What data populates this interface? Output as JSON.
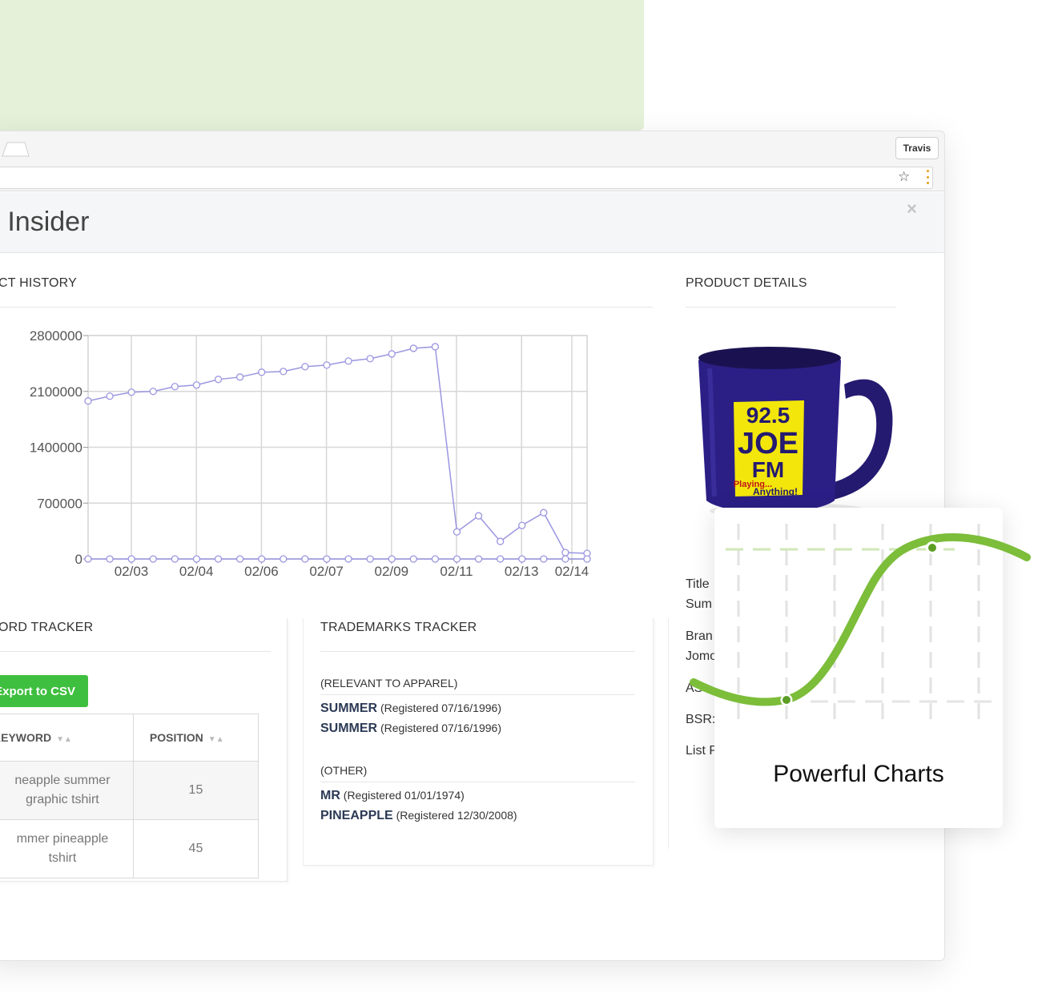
{
  "browser": {
    "profile_name": "Travis"
  },
  "modal": {
    "title": "n Insider"
  },
  "history": {
    "section_title": "CT HISTORY"
  },
  "chart_data": {
    "type": "line",
    "x_tick_labels": [
      "02/03",
      "02/04",
      "02/06",
      "02/07",
      "02/09",
      "02/11",
      "02/13",
      "02/14"
    ],
    "y_tick_labels": [
      "2800000",
      "2100000",
      "1400000",
      "700000",
      "0"
    ],
    "ylim": [
      0,
      2800000
    ],
    "grid": true,
    "series": [
      {
        "color": "#9b96e0",
        "values": [
          1980000,
          2040000,
          2090000,
          2100000,
          2160000,
          2180000,
          2250000,
          2280000,
          2340000,
          2350000,
          2410000,
          2430000,
          2480000,
          2510000,
          2570000,
          2640000,
          2660000,
          340000,
          540000,
          220000,
          420000,
          580000,
          80000,
          70000
        ]
      },
      {
        "color": "#9b96e0",
        "values": [
          0,
          0,
          0,
          0,
          0,
          0,
          0,
          0,
          0,
          0,
          0,
          0,
          0,
          0,
          0,
          0,
          0,
          0,
          0,
          0,
          0,
          0,
          0,
          0
        ]
      }
    ]
  },
  "keyword_tracker": {
    "section_title": "ORD TRACKER",
    "export_label": "Export to CSV",
    "columns": [
      "KEYWORD",
      "POSITION"
    ],
    "rows": [
      {
        "keyword_line1": "neapple summer",
        "keyword_line2": "graphic tshirt",
        "position": "15"
      },
      {
        "keyword_line1": "mmer pineapple",
        "keyword_line2": "tshirt",
        "position": "45"
      }
    ]
  },
  "trademarks": {
    "section_title": "TRADEMARKS TRACKER",
    "groups": [
      {
        "label": "(RELEVANT TO APPAREL)",
        "items": [
          {
            "mark": "SUMMER",
            "detail": "(Registered 07/16/1996)"
          },
          {
            "mark": "SUMMER",
            "detail": "(Registered 07/16/1996)"
          }
        ]
      },
      {
        "label": "(OTHER)",
        "items": [
          {
            "mark": "MR",
            "detail": "(Registered 01/01/1974)"
          },
          {
            "mark": "PINEAPPLE",
            "detail": "(Registered 12/30/2008)"
          }
        ]
      }
    ]
  },
  "product_details": {
    "section_title": "PRODUCT DETAILS",
    "image_text": [
      "92.5",
      "JOE",
      "FM",
      "Playing...",
      "Anything!"
    ],
    "fields": [
      "Title",
      "Sum",
      "Bran",
      "Jomo",
      "AS",
      "BSR:",
      "List P"
    ]
  },
  "feature_card": {
    "label": "Powerful Charts",
    "accent": "#7cbd3a"
  }
}
